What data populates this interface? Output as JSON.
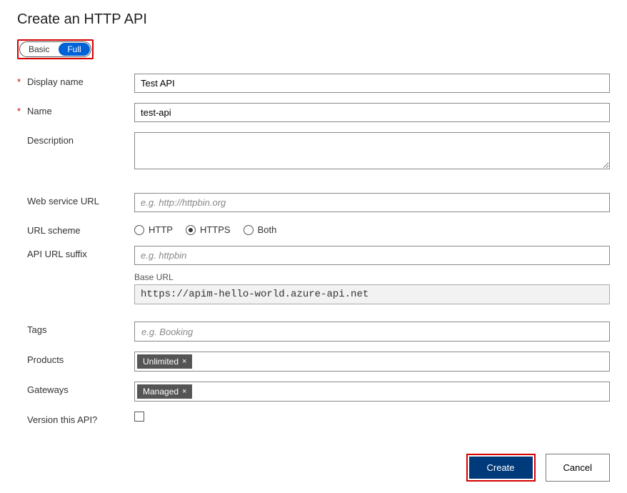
{
  "title": "Create an HTTP API",
  "toggle": {
    "basic": "Basic",
    "full": "Full"
  },
  "fields": {
    "display_name": {
      "label": "Display name",
      "value": "Test API"
    },
    "name": {
      "label": "Name",
      "value": "test-api"
    },
    "description": {
      "label": "Description",
      "value": ""
    },
    "web_service_url": {
      "label": "Web service URL",
      "placeholder": "e.g. http://httpbin.org"
    },
    "url_scheme": {
      "label": "URL scheme",
      "options": {
        "http": "HTTP",
        "https": "HTTPS",
        "both": "Both"
      },
      "selected": "https"
    },
    "api_url_suffix": {
      "label": "API URL suffix",
      "placeholder": "e.g. httpbin"
    },
    "base_url": {
      "label": "Base URL",
      "value": "https://apim-hello-world.azure-api.net"
    },
    "tags": {
      "label": "Tags",
      "placeholder": "e.g. Booking"
    },
    "products": {
      "label": "Products",
      "chip": "Unlimited"
    },
    "gateways": {
      "label": "Gateways",
      "chip": "Managed"
    },
    "version": {
      "label": "Version this API?"
    }
  },
  "buttons": {
    "create": "Create",
    "cancel": "Cancel"
  },
  "icons": {
    "remove": "×"
  }
}
